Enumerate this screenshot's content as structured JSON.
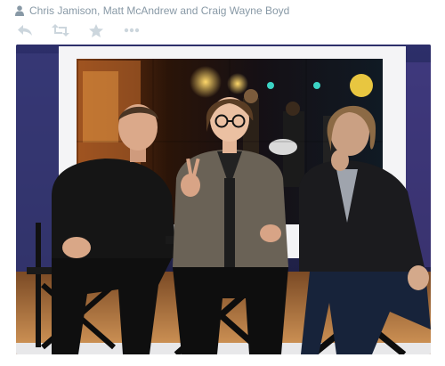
{
  "tagline": {
    "icon": "person-icon",
    "text": "Chris Jamison, Matt McAndrew and Craig Wayne Boyd"
  },
  "actions": [
    {
      "icon": "reply-icon",
      "name": "reply"
    },
    {
      "icon": "retweet-icon",
      "name": "retweet"
    },
    {
      "icon": "favorite-star-icon",
      "name": "favorite"
    },
    {
      "icon": "more-icon",
      "name": "more"
    }
  ],
  "colors": {
    "muted": "#8899a6",
    "action_icon": "#ccd6dd"
  },
  "photo": {
    "description_icon": "photo-image"
  }
}
